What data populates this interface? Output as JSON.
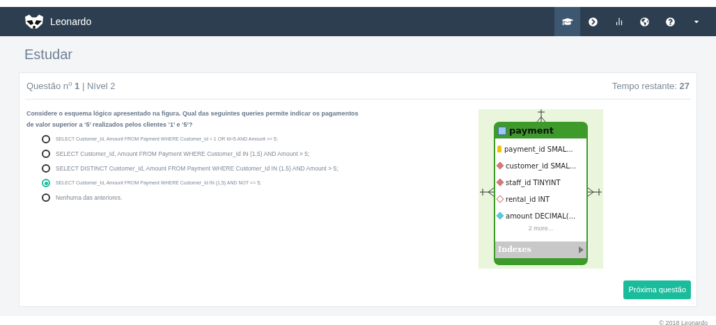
{
  "navbar": {
    "brand": "Leonardo",
    "items": [
      {
        "kind": "study",
        "selected": true
      },
      {
        "kind": "next",
        "selected": false
      },
      {
        "kind": "stats",
        "selected": false
      },
      {
        "kind": "globe",
        "selected": false
      },
      {
        "kind": "help",
        "selected": false
      },
      {
        "kind": "caret",
        "selected": false
      }
    ]
  },
  "page_title": "Estudar",
  "question": {
    "header": "Questão n$^{o}$ **1** | Nível 2",
    "timer": "Tempo restante: **27**",
    "prompt": "Considere o esquema lógico apresentado na figura. Qual das seguintes queries permite indicar os pagamentos de valor superior a ‘5’ realizados pelos clientes ‘1’ e ‘5’?",
    "options": [
      {
        "text": "SELECT Customer_Id, Amount FROM Payment WHERE Customer_Id = 1 OR Id=5 AND Amount >= 5;",
        "selected": false,
        "small": true
      },
      {
        "text": "SELECT Customer_Id, Amount FROM Payment WHERE Customer_Id IN (1,5) AND Amount > 5;",
        "selected": false,
        "small": false
      },
      {
        "text": "SELECT DISTINCT Customer_Id, Amount FROM Payment WHERE Customer_Id IN (1.5) AND Amount > 5;",
        "selected": false,
        "small": false
      },
      {
        "text": "SELECT Customer_Id, Amount FROM Payment WHERE Customer_Id IN (1,5) AND NOT <= 5;",
        "selected": true,
        "small": true
      },
      {
        "text": "Nenhuma das anteriores.",
        "selected": false,
        "small": false
      }
    ]
  },
  "diagram": {
    "table": "payment",
    "columns": [
      {
        "text": "payment_id SMAL...",
        "kind": "key"
      },
      {
        "text": "customer_id SMAL...",
        "kind": "foreign"
      },
      {
        "text": "staff_id TINYINT",
        "kind": "foreign"
      },
      {
        "text": "rental_id INT",
        "kind": "nullable"
      },
      {
        "text": "amount DECIMAL(...",
        "kind": "plain"
      }
    ],
    "more": "2 more...",
    "indexes": "Indexes"
  },
  "next_button": "Próxima questão",
  "footer": "© 2018 Leonardo"
}
